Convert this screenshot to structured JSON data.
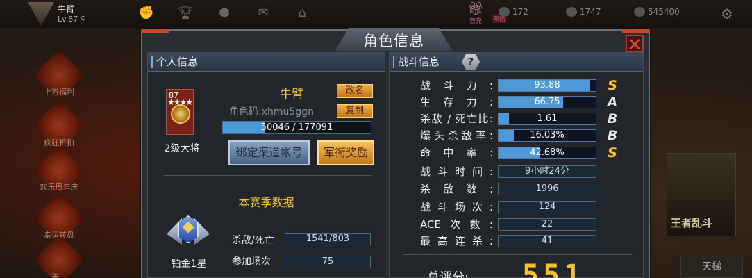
{
  "topbar": {
    "player_name": "牛臂",
    "player_level": "Lv.87",
    "first_recharge": "首充",
    "double_badge": "双倍",
    "currencies": [
      {
        "icon": "diamond-icon",
        "value": "172"
      },
      {
        "icon": "gem-icon",
        "value": "1747"
      },
      {
        "icon": "coin-icon",
        "value": "545400"
      }
    ]
  },
  "side_menu": [
    {
      "label": "上万福利"
    },
    {
      "label": "疯狂折扣"
    },
    {
      "label": "欢乐周年庆"
    },
    {
      "label": "幸运转盘"
    },
    {
      "label": "天..."
    }
  ],
  "right_tiles": {
    "tile_label": "王者乱斗",
    "ladder_label": "天梯"
  },
  "dialog": {
    "title": "角色信息",
    "left_header": "个人信息",
    "right_header": "战斗信息"
  },
  "profile": {
    "avatar_level": "87",
    "rank": "2级大将",
    "name": "牛臂",
    "role_code": "角色码:xhmu5ggn",
    "rename_label": "改名",
    "copy_label": "复制",
    "exp_text": "50046 / 177091",
    "exp_current": 50046,
    "exp_max": 177091,
    "bind_label": "绑定渠道帐号",
    "medal_label": "军衔奖励"
  },
  "season": {
    "title": "本赛季数据",
    "tier": "铂金1星",
    "rows": [
      {
        "label": "杀敌/死亡",
        "value": "1541/803"
      },
      {
        "label": "参加场次",
        "value": "75"
      }
    ]
  },
  "combat": {
    "bars": [
      {
        "label": "战斗力:",
        "value": "93.88",
        "fill": 0.9388,
        "grade": "S"
      },
      {
        "label": "生存力:",
        "value": "66.75",
        "fill": 0.6675,
        "grade": "A"
      },
      {
        "label": "杀敌 / 死亡比:",
        "value": "1.61",
        "fill": 0.11,
        "grade": "B"
      },
      {
        "label": "爆头杀敌率:",
        "value": "16.03%",
        "fill": 0.1603,
        "grade": "B"
      },
      {
        "label": "命中率:",
        "value": "42.68%",
        "fill": 0.4268,
        "grade": "S"
      }
    ],
    "info": [
      {
        "label": "战斗时间:",
        "value": "9小时24分"
      },
      {
        "label": "杀敌数:",
        "value": "1996"
      },
      {
        "label": "战斗场次:",
        "value": "124"
      },
      {
        "label": "ACE次数:",
        "value": "22"
      },
      {
        "label": "最高连杀:",
        "value": "41"
      }
    ],
    "total_label": "总评分:",
    "total_value": "551"
  },
  "colors": {
    "accent_gold": "#f2c230",
    "bar_blue": "#4f98d8",
    "close_red": "#e9462a"
  }
}
